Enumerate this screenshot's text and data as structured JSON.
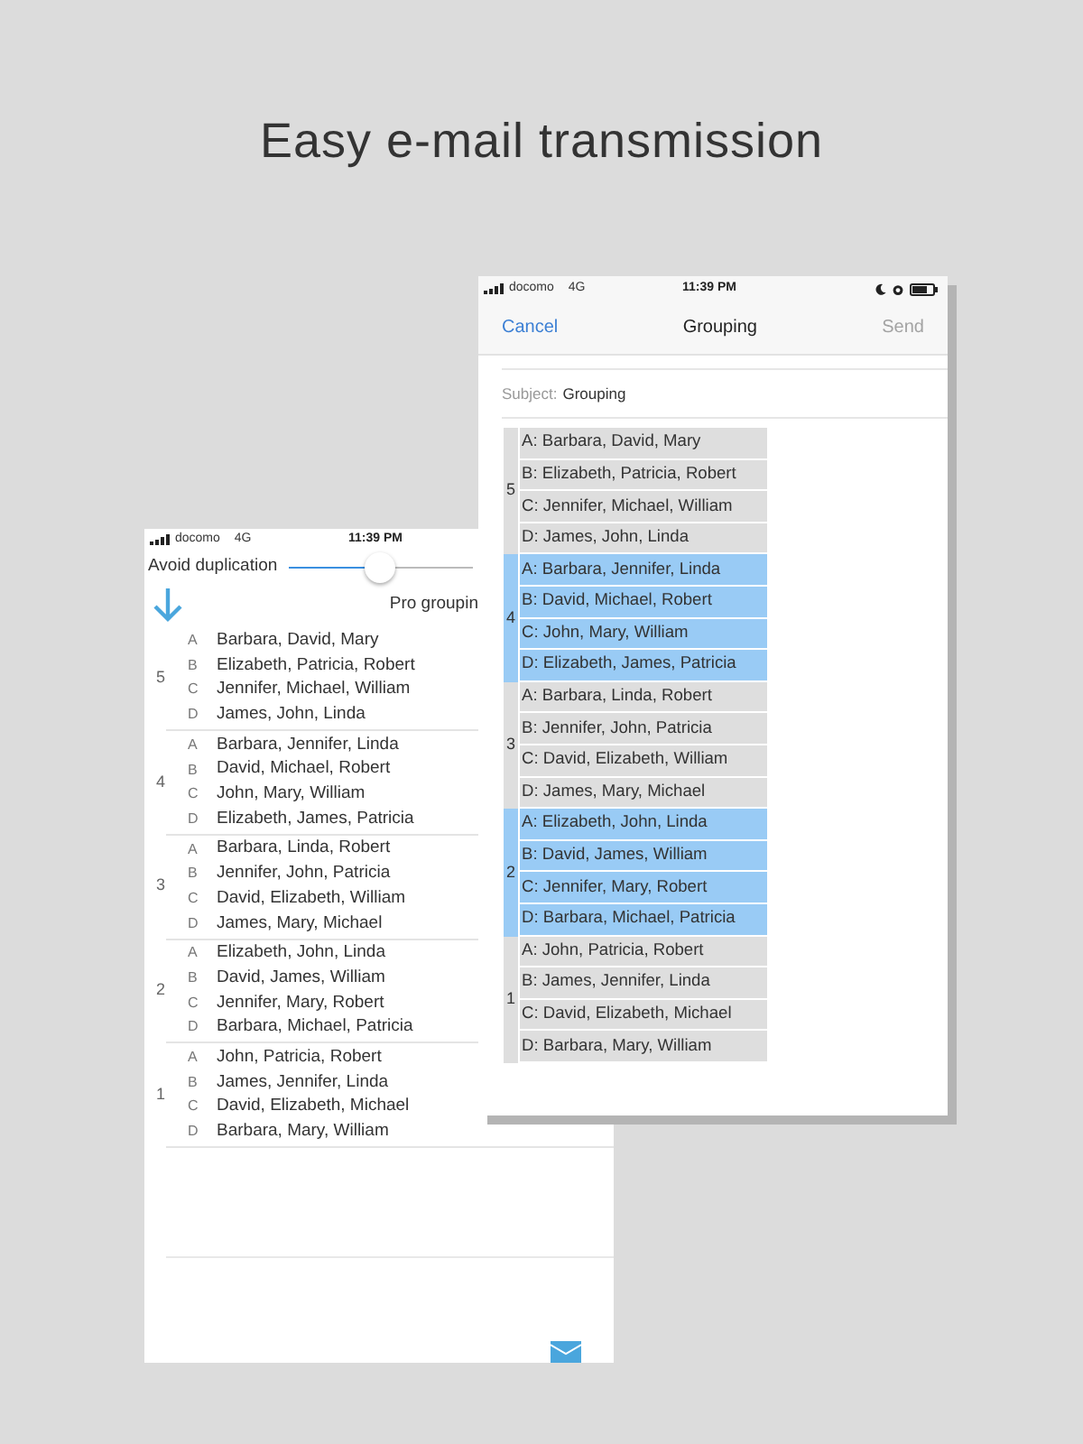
{
  "headline": "Easy e-mail transmission",
  "back_screen": {
    "status_bar": {
      "carrier": "docomo",
      "network": "4G",
      "time": "11:39 PM"
    },
    "slider": {
      "label": "Avoid duplication",
      "level": 0.5
    },
    "pro_button": "Pro groupin",
    "groups": [
      {
        "number": "5",
        "members": [
          {
            "letter": "A",
            "names": "Barbara, David, Mary"
          },
          {
            "letter": "B",
            "names": "Elizabeth, Patricia, Robert"
          },
          {
            "letter": "C",
            "names": "Jennifer, Michael, William"
          },
          {
            "letter": "D",
            "names": "James, John, Linda"
          }
        ]
      },
      {
        "number": "4",
        "members": [
          {
            "letter": "A",
            "names": "Barbara, Jennifer, Linda"
          },
          {
            "letter": "B",
            "names": "David, Michael, Robert"
          },
          {
            "letter": "C",
            "names": "John, Mary, William"
          },
          {
            "letter": "D",
            "names": "Elizabeth, James, Patricia"
          }
        ]
      },
      {
        "number": "3",
        "members": [
          {
            "letter": "A",
            "names": "Barbara, Linda, Robert"
          },
          {
            "letter": "B",
            "names": "Jennifer, John, Patricia"
          },
          {
            "letter": "C",
            "names": "David, Elizabeth, William"
          },
          {
            "letter": "D",
            "names": "James, Mary, Michael"
          }
        ]
      },
      {
        "number": "2",
        "members": [
          {
            "letter": "A",
            "names": "Elizabeth, John, Linda"
          },
          {
            "letter": "B",
            "names": "David, James, William"
          },
          {
            "letter": "C",
            "names": "Jennifer, Mary, Robert"
          },
          {
            "letter": "D",
            "names": "Barbara, Michael, Patricia"
          }
        ]
      },
      {
        "number": "1",
        "members": [
          {
            "letter": "A",
            "names": "John, Patricia, Robert"
          },
          {
            "letter": "B",
            "names": "James, Jennifer, Linda"
          },
          {
            "letter": "C",
            "names": "David, Elizabeth, Michael"
          },
          {
            "letter": "D",
            "names": "Barbara, Mary, William"
          }
        ]
      }
    ]
  },
  "front_screen": {
    "status_bar": {
      "carrier": "docomo",
      "network": "4G",
      "time": "11:39 PM"
    },
    "nav": {
      "cancel": "Cancel",
      "title": "Grouping",
      "send": "Send",
      "send_disabled": true
    },
    "subject": {
      "label": "Subject:",
      "value": "Grouping"
    },
    "groups": [
      {
        "number": "5",
        "highlighted": false,
        "lines": [
          "A: Barbara, David, Mary",
          "B: Elizabeth, Patricia, Robert",
          "C: Jennifer, Michael, William",
          "D: James, John, Linda"
        ]
      },
      {
        "number": "4",
        "highlighted": true,
        "lines": [
          "A: Barbara, Jennifer, Linda",
          "B: David, Michael, Robert",
          "C: John, Mary, William",
          "D: Elizabeth, James, Patricia"
        ]
      },
      {
        "number": "3",
        "highlighted": false,
        "lines": [
          "A: Barbara, Linda, Robert",
          "B: Jennifer, John, Patricia",
          "C: David, Elizabeth, William",
          "D: James, Mary, Michael"
        ]
      },
      {
        "number": "2",
        "highlighted": true,
        "lines": [
          "A: Elizabeth, John, Linda",
          "B: David, James, William",
          "C: Jennifer, Mary, Robert",
          "D: Barbara, Michael, Patricia"
        ]
      },
      {
        "number": "1",
        "highlighted": false,
        "lines": [
          "A: John, Patricia, Robert",
          "B: James, Jennifer, Linda",
          "C: David, Elizabeth, Michael",
          "D: Barbara, Mary, William"
        ]
      }
    ]
  }
}
